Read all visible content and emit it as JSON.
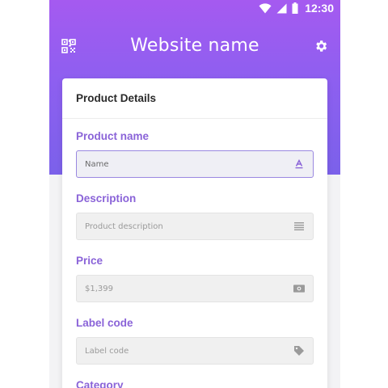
{
  "statusbar": {
    "time": "12:30"
  },
  "appbar": {
    "title": "Website name",
    "left_icon": "qr-code-icon",
    "right_icon": "gear-icon"
  },
  "colors": {
    "gradient_top": "#a55af0",
    "gradient_bottom": "#7b61ea",
    "accent_label": "#8a63d8",
    "focus_border": "#9a88e0"
  },
  "card": {
    "title": "Product Details",
    "fields": [
      {
        "label": "Product name",
        "placeholder": "Name",
        "icon": "text-format-icon"
      },
      {
        "label": "Description",
        "placeholder": "Product description",
        "icon": "list-lines-icon"
      },
      {
        "label": "Price",
        "placeholder": "$1,399",
        "icon": "money-bill-icon"
      },
      {
        "label": "Label code",
        "placeholder": "Label code",
        "icon": "tag-icon"
      },
      {
        "label": "Category"
      }
    ]
  }
}
